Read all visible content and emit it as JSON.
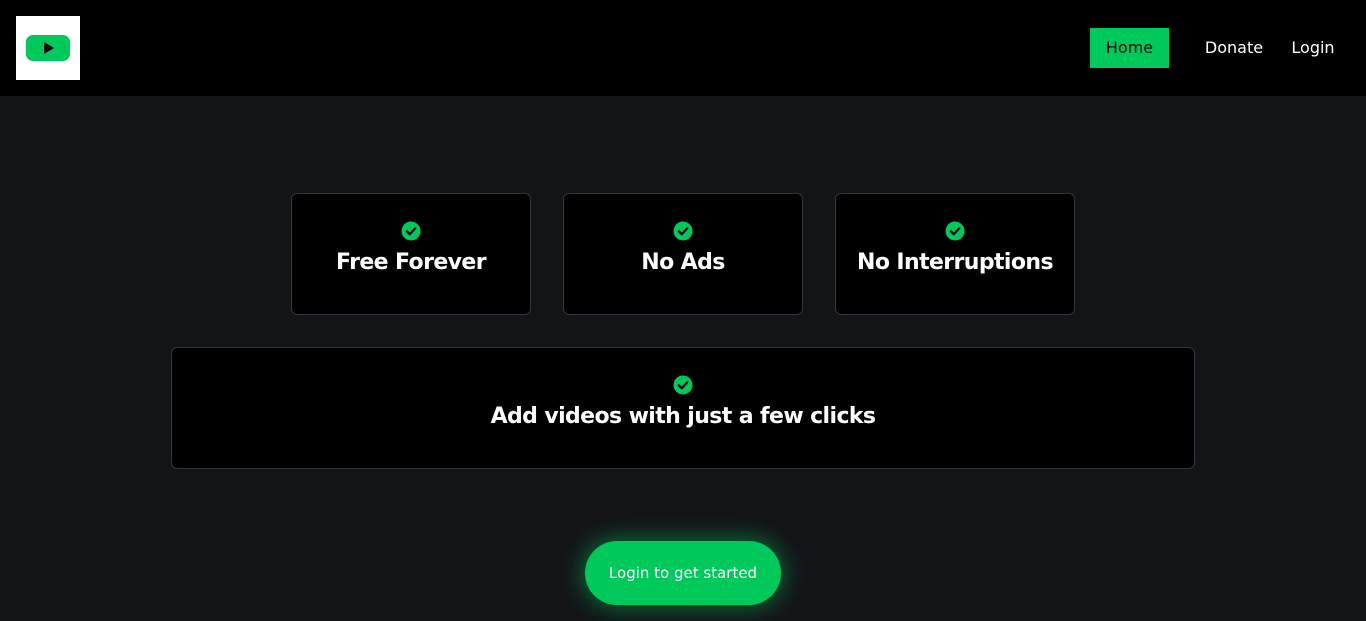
{
  "header": {
    "logo_icon": "play-button-icon",
    "nav": [
      {
        "label": "Home",
        "active": true
      },
      {
        "label": "Donate",
        "active": false
      },
      {
        "label": "Login",
        "active": false
      }
    ]
  },
  "features": [
    {
      "icon": "check-circle-icon",
      "title": "Free Forever"
    },
    {
      "icon": "check-circle-icon",
      "title": "No Ads"
    },
    {
      "icon": "check-circle-icon",
      "title": "No Interruptions"
    },
    {
      "icon": "check-circle-icon",
      "title": "Add videos with just a few clicks"
    }
  ],
  "cta": {
    "label": "Login to get started"
  },
  "colors": {
    "accent": "#00c95c",
    "background": "#131418",
    "header": "#000000",
    "card": "#000000"
  }
}
